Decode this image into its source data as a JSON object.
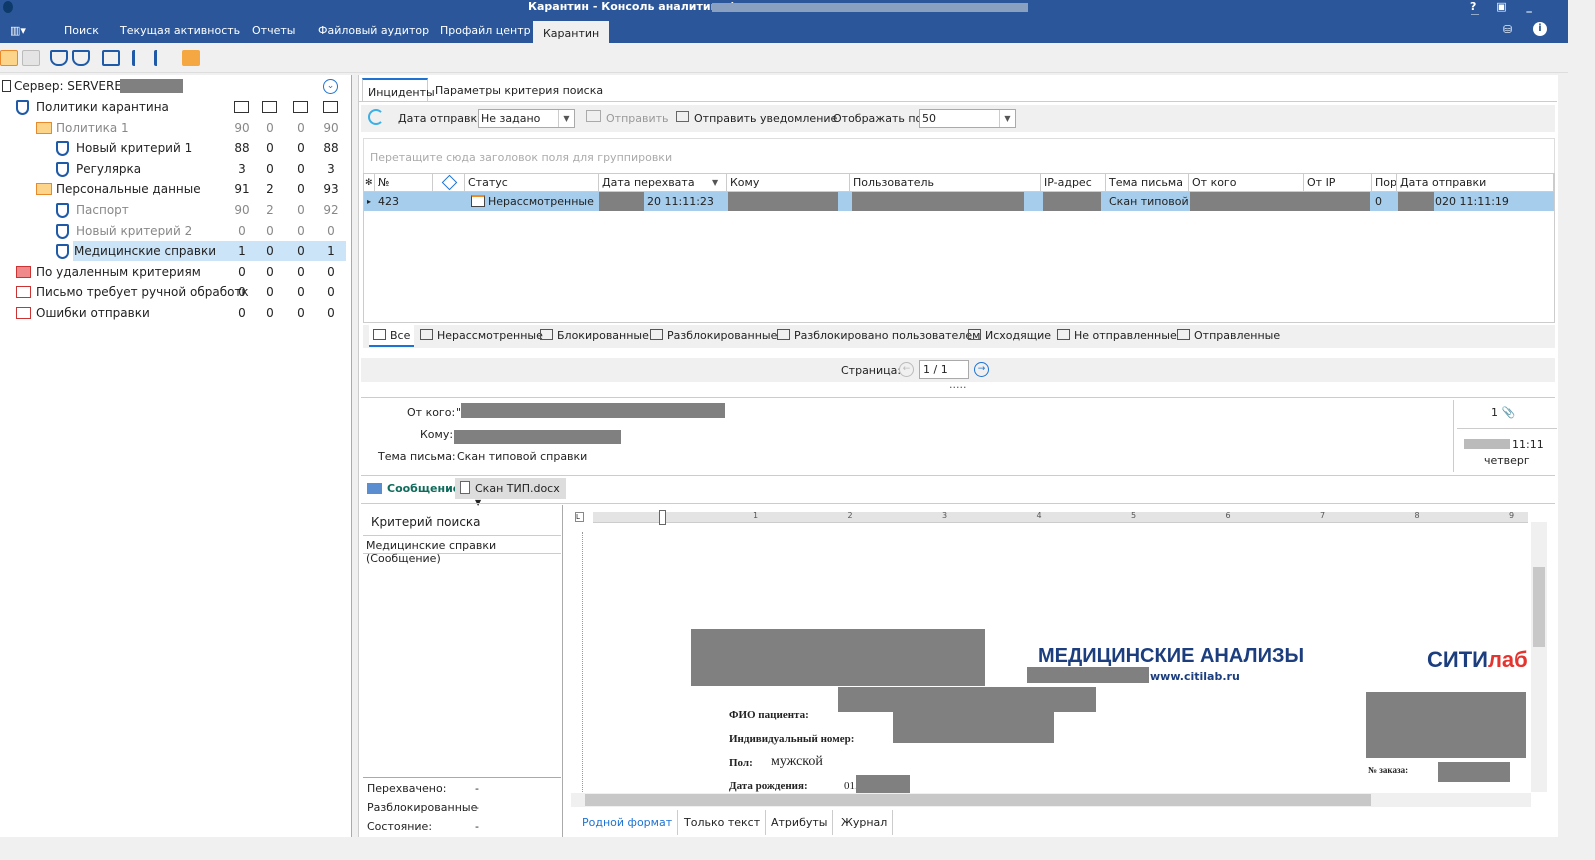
{
  "window": {
    "title": "Карантин - Консоль аналитика (",
    "controls": [
      "?",
      "restore-up",
      "_",
      "restore",
      "x"
    ]
  },
  "menu": {
    "tabs": [
      "Поиск",
      "Текущая активность",
      "Отчеты",
      "Файловый аудитор",
      "Профайл центр",
      "Карантин"
    ],
    "active": "Карантин"
  },
  "tree": {
    "server": "Сервер: SERVERES",
    "rows": [
      {
        "label": "Политики карантина",
        "icon": "shield-lock-icon",
        "level": 1,
        "counts": [],
        "grey": false
      },
      {
        "label": "Политика 1",
        "icon": "folder-icon",
        "level": 2,
        "counts": [
          "90",
          "0",
          "0",
          "90"
        ],
        "grey": true
      },
      {
        "label": "Новый критерий 1",
        "icon": "shield-icon",
        "level": 3,
        "counts": [
          "88",
          "0",
          "0",
          "88"
        ],
        "grey": false
      },
      {
        "label": "Регулярка",
        "icon": "shield-icon",
        "level": 3,
        "counts": [
          "3",
          "0",
          "0",
          "3"
        ],
        "grey": false
      },
      {
        "label": "Персональные данные",
        "icon": "folder-icon",
        "level": 2,
        "counts": [
          "91",
          "2",
          "0",
          "93"
        ],
        "grey": false
      },
      {
        "label": "Паспорт",
        "icon": "shield-icon",
        "level": 3,
        "counts": [
          "90",
          "2",
          "0",
          "92"
        ],
        "grey": true
      },
      {
        "label": "Новый критерий 2",
        "icon": "shield-icon",
        "level": 3,
        "counts": [
          "0",
          "0",
          "0",
          "0"
        ],
        "grey": true
      },
      {
        "label": "Медицинские справки",
        "icon": "shield-icon",
        "level": 3,
        "counts": [
          "1",
          "0",
          "0",
          "1"
        ],
        "grey": false,
        "selected": true
      },
      {
        "label": "По удаленным критериям",
        "icon": "deleted-folder-icon",
        "level": 1,
        "counts": [
          "0",
          "0",
          "0",
          "0"
        ],
        "grey": false
      },
      {
        "label": "Письмо требует ручной обработк",
        "icon": "manual-mail-icon",
        "level": 1,
        "counts": [
          "0",
          "0",
          "0",
          "0"
        ],
        "grey": false
      },
      {
        "label": "Ошибки отправки",
        "icon": "mail-error-icon",
        "level": 1,
        "counts": [
          "0",
          "0",
          "0",
          "0"
        ],
        "grey": false
      }
    ]
  },
  "main": {
    "tabs": [
      "Инциденты",
      "Параметры критерия поиска"
    ],
    "toolbar": {
      "date_label": "Дата отправки",
      "date_value": "Не задано",
      "send": "Отправить",
      "notify": "Отправить уведомление",
      "show_label": "Отображать по:",
      "show_value": "50"
    },
    "group_hint": "Перетащите сюда заголовок поля для группировки",
    "columns": [
      "№",
      "",
      "Статус",
      "Дата перехвата",
      "Кому",
      "Пользователь",
      "IP-адрес",
      "Тема письма",
      "От кого",
      "От IP",
      "Пор",
      "Дата отправки"
    ],
    "row": {
      "num": "423",
      "status": "Нерассмотренные",
      "intercept": "20 11:11:23",
      "subject": "Скан типовой сі",
      "priority": "0",
      "sent": "020 11:11:19"
    },
    "filters": [
      "Все",
      "Нерассмотренные",
      "Блокированные",
      "Разблокированные",
      "Разблокировано пользователем",
      "Исходящие",
      "Не отправленные",
      "Отправленные"
    ],
    "pager": {
      "label": "Страница:",
      "value": "1 / 1"
    },
    "detail": {
      "from_label": "От кого:",
      "from_value": "\"",
      "to_label": "Кому:",
      "subject_label": "Тема письма:",
      "subject_value": "Скан типовой справки",
      "attach_count": "1",
      "time": "11:11",
      "weekday": "четверг"
    },
    "attach": {
      "message": "Сообщение",
      "file": "Скан ТИП.docx"
    },
    "criteria": {
      "title": "Критерий поиска",
      "item": "Медицинские справки (Сообщение)",
      "stats": [
        {
          "k": "Перехвачено:",
          "v": "-"
        },
        {
          "k": "Разблокированные",
          "v": "-"
        },
        {
          "k": "Состояние:",
          "v": "-"
        }
      ]
    },
    "document": {
      "ruler": [
        "1",
        "2",
        "3",
        "4",
        "5",
        "6",
        "7",
        "8",
        "9"
      ],
      "heading": "МЕДИЦИНСКИЕ АНАЛИЗЫ",
      "site": "www.citilab.ru",
      "logo_a": "СИТИ",
      "logo_b": "ЛАБ",
      "fio": "ФИО пациента:",
      "id": "Индивидуальный номер:",
      "sex_label": "Пол:",
      "sex": "мужской",
      "dob": "Дата рождения:",
      "dob_val": "01.",
      "order": "№ заказа:"
    },
    "view_tabs": [
      "Родной формат",
      "Только текст",
      "Атрибуты",
      "Журнал"
    ]
  },
  "colors": {
    "brand": "#2b579a",
    "selection": "#a6cdec",
    "link": "#1e73d2"
  }
}
